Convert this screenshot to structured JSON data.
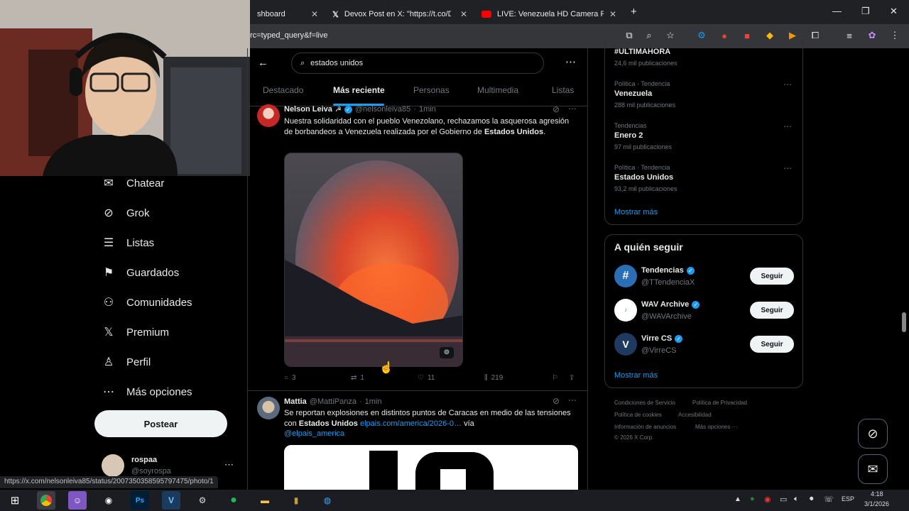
{
  "browser": {
    "tabs": [
      {
        "title": "shboard"
      },
      {
        "title": "Devox Post en X: \"https://t.co/D"
      },
      {
        "title": "LIVE: Venezuela HD Camera Fe"
      }
    ],
    "new_tab": "+",
    "url": "rc=typed_query&f=live",
    "status_url": "https://x.com/nelsonleiva85/status/2007350358595797475/photo/1"
  },
  "sidebar": {
    "items": [
      {
        "label": "Chatear",
        "icon": "chat-icon"
      },
      {
        "label": "Grok",
        "icon": "grok-icon"
      },
      {
        "label": "Listas",
        "icon": "list-icon"
      },
      {
        "label": "Guardados",
        "icon": "bookmark-icon"
      },
      {
        "label": "Comunidades",
        "icon": "communities-icon"
      },
      {
        "label": "Premium",
        "icon": "x-icon"
      },
      {
        "label": "Perfil",
        "icon": "profile-icon"
      },
      {
        "label": "Más opciones",
        "icon": "more-icon"
      }
    ],
    "post_label": "Postear",
    "account": {
      "name": "rospaa",
      "handle": "@soyrospa"
    }
  },
  "search": {
    "query": "estados unidos",
    "tabs": [
      "Destacado",
      "Más reciente",
      "Personas",
      "Multimedia",
      "Listas"
    ]
  },
  "tweets": [
    {
      "name": "Nelson Leiva",
      "handle": "@nelsonleiva85",
      "time": "1min",
      "text_a": "Nuestra solidaridad con el pueblo Venezolano, rechazamos la asquerosa agresión de borbandeos a Venezuela realizada por el Gobierno de ",
      "text_b": "Estados Unidos",
      "text_c": ".",
      "replies": "3",
      "reposts": "1",
      "likes": "11",
      "views": "219"
    },
    {
      "name": "Mattia",
      "handle": "@MattiPanza",
      "time": "1min",
      "text_a": "Se reportan explosiones en distintos puntos de Caracas en medio de las tensiones con ",
      "text_b": "Estados Unidos",
      "text_link": "elpais.com/america/2026-0…",
      "text_via": "vía",
      "text_mention": "@elpais_america"
    }
  ],
  "trends": [
    {
      "meta": "",
      "title": "#ULTIMAHORA",
      "count": "24,6 mil publicaciones"
    },
    {
      "meta": "Política · Tendencia",
      "title": "Venezuela",
      "count": "288 mil publicaciones"
    },
    {
      "meta": "Tendencias",
      "title": "Enero 2",
      "count": "97 mil publicaciones"
    },
    {
      "meta": "Política · Tendencia",
      "title": "Estados Unidos",
      "count": "93,2 mil publicaciones"
    }
  ],
  "trends_more": "Mostrar más",
  "follow": {
    "title": "A quién seguir",
    "accounts": [
      {
        "name": "Tendencias",
        "handle": "@TTendenciaX",
        "button": "Seguir"
      },
      {
        "name": "WAV Archive",
        "handle": "@WAVArchive",
        "button": "Seguir"
      },
      {
        "name": "Virre CS",
        "handle": "@VirreCS",
        "button": "Seguir"
      }
    ],
    "more": "Mostrar más"
  },
  "footer": {
    "links": [
      "Condiciones de Servicio",
      "Política de Privacidad",
      "Política de cookies",
      "Accesibilidad",
      "Información de anuncios",
      "Más opciones ···"
    ],
    "copyright": "© 2026 X Corp."
  },
  "taskbar": {
    "lang": "ESP",
    "time": "4:18",
    "date": "3/1/2026"
  },
  "colors": {
    "accent": "#1d9bf0",
    "background": "#000000",
    "border": "#2f3336"
  }
}
